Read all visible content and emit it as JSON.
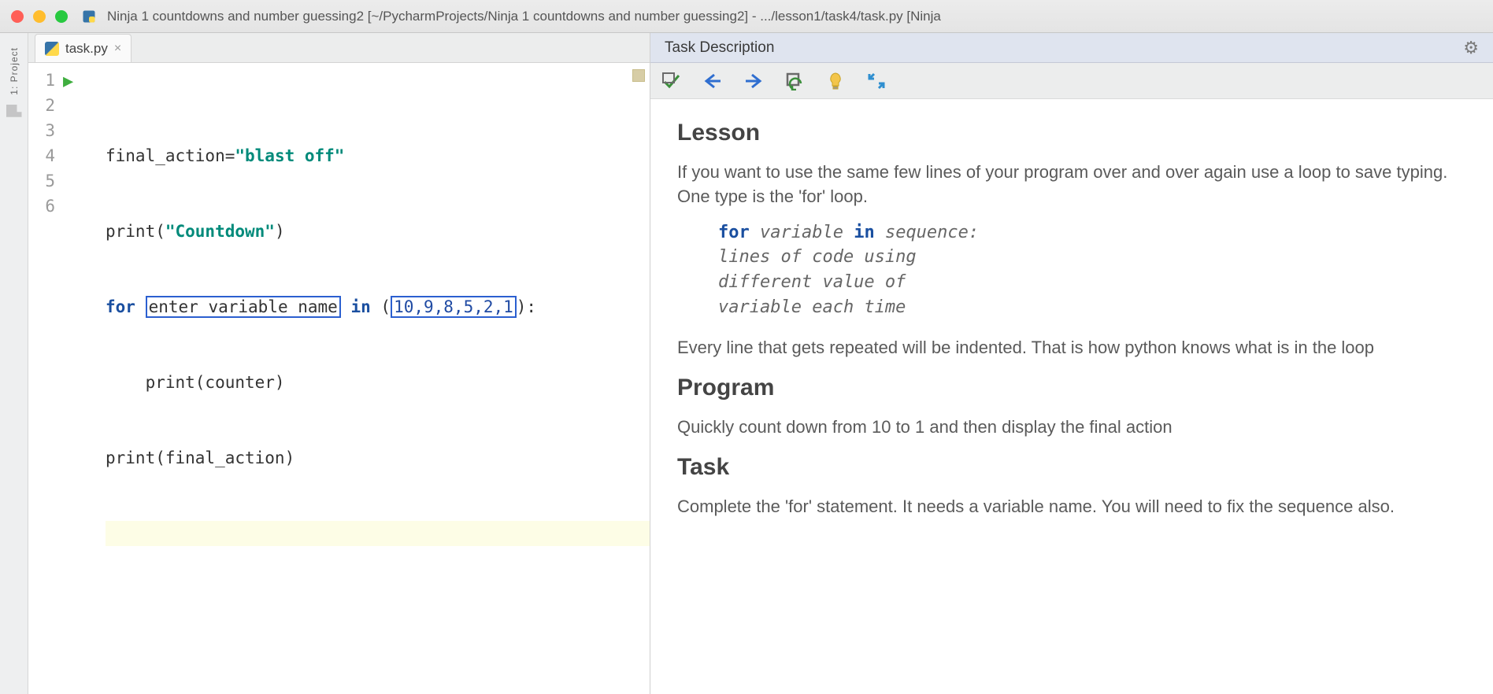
{
  "window": {
    "title": "Ninja 1 countdowns and number guessing2 [~/PycharmProjects/Ninja 1 countdowns and number guessing2] - .../lesson1/task4/task.py [Ninja"
  },
  "left_rail": {
    "project_label": "1: Project"
  },
  "editor": {
    "tab_name": "task.py",
    "line_numbers": [
      "1",
      "2",
      "3",
      "4",
      "5",
      "6"
    ],
    "code": {
      "l1_a": "final_action=",
      "l1_str": "\"blast off\"",
      "l2_a": "print(",
      "l2_str": "\"Countdown\"",
      "l2_b": ")",
      "l3_for": "for",
      "l3_placeholder": "enter variable name",
      "l3_in": "in",
      "l3_open": " (",
      "l3_nums": "10,9,8,5,2,1",
      "l3_close": "):",
      "l4": "    print(counter)",
      "l5": "print(final_action)"
    }
  },
  "task": {
    "header": "Task Description",
    "lesson_h": "Lesson",
    "lesson_p1": "If you want to use the same few lines of your program over and over again use a loop to save typing. One type is the 'for' loop.",
    "snippet": {
      "l1_for": "for",
      "l1_var": " variable ",
      "l1_in": "in",
      "l1_seq": " sequence:",
      "l2": "    lines of code using",
      "l3": "    different value of",
      "l4": "    variable each time"
    },
    "lesson_p2": "Every line that gets repeated will be indented. That is how python knows what is in the loop",
    "program_h": "Program",
    "program_p": "Quickly count down from 10 to 1 and then display the final action",
    "task_h": "Task",
    "task_p": "Complete the 'for' statement. It needs a variable name. You will need to fix the sequence also."
  }
}
